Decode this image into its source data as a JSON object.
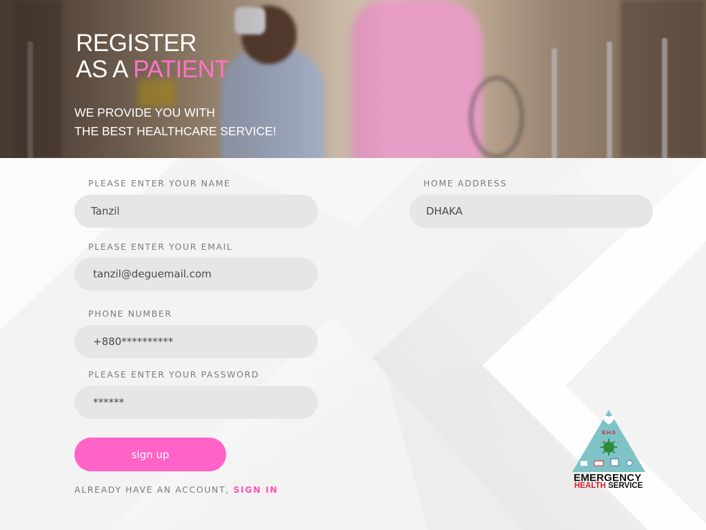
{
  "hero": {
    "title_line1": "REGISTER",
    "title_line2_prefix": "AS A ",
    "title_line2_accent": "PATIENT",
    "subtitle_line1": "WE PROVIDE YOU WITH",
    "subtitle_line2": "THE BEST HEALTHCARE SERVICE!"
  },
  "form": {
    "name": {
      "label": "PLEASE ENTER YOUR NAME",
      "value": "Tanzil"
    },
    "email": {
      "label": "PLEASE ENTER YOUR EMAIL",
      "value": "tanzil@deguemail.com"
    },
    "phone": {
      "label": "PHONE NUMBER",
      "value": "+880**********"
    },
    "password": {
      "label": "PLEASE ENTER YOUR PASSWORD",
      "value": "******"
    },
    "address": {
      "label": "HOME ADDRESS",
      "value": "DHAKA"
    },
    "submit_label": "sign up"
  },
  "footer": {
    "prompt": "ALREADY HAVE AN ACCOUNT, ",
    "signin_label": "SIGN IN"
  },
  "logo": {
    "badge": "E.H.S",
    "line1": "EMERGENCY",
    "line2_red": "HEALTH",
    "line2_black": " SERVICE"
  },
  "colors": {
    "accent_pink": "#ff63c7",
    "field_bg": "#e6e6e6",
    "logo_teal": "#7fc3c6",
    "logo_red": "#d8202a"
  }
}
